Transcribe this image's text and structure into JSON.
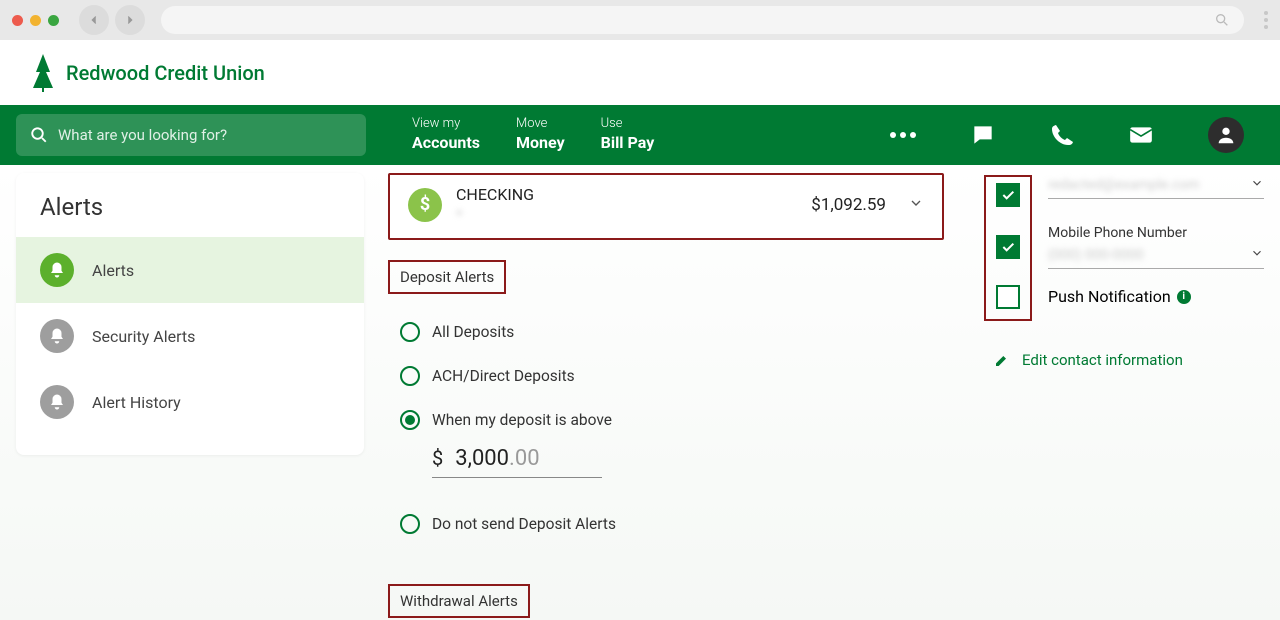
{
  "brand": {
    "name": "Redwood Credit Union"
  },
  "nav": {
    "search_placeholder": "What are you looking for?",
    "items": [
      {
        "top": "View my",
        "bottom": "Accounts"
      },
      {
        "top": "Move",
        "bottom": "Money"
      },
      {
        "top": "Use",
        "bottom": "Bill Pay"
      }
    ]
  },
  "sidebar": {
    "title": "Alerts",
    "items": [
      {
        "label": "Alerts",
        "active": true
      },
      {
        "label": "Security Alerts",
        "active": false
      },
      {
        "label": "Alert History",
        "active": false
      }
    ]
  },
  "account": {
    "name": "CHECKING",
    "masked_number": "*",
    "balance": "$1,092.59"
  },
  "deposit_section": {
    "title": "Deposit Alerts",
    "options": {
      "all": "All Deposits",
      "ach": "ACH/Direct Deposits",
      "above": "When my deposit is above",
      "above_currency": "$",
      "above_value_int": "3,000",
      "above_value_dec": ".00",
      "none": "Do not send Deposit Alerts"
    },
    "selected": "above"
  },
  "withdrawal_section": {
    "title": "Withdrawal Alerts"
  },
  "contact": {
    "email_value": "redacted@example.com",
    "mobile_label": "Mobile Phone Number",
    "mobile_value": "(000) 000-0000",
    "push_label": "Push Notification",
    "edit_label": "Edit contact information"
  }
}
